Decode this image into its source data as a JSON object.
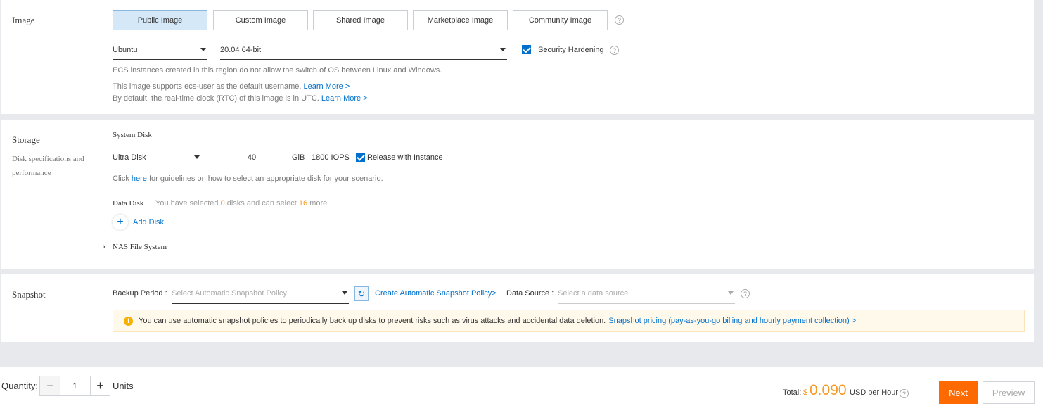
{
  "image": {
    "title": "Image",
    "tabs": [
      "Public Image",
      "Custom Image",
      "Shared Image",
      "Marketplace Image",
      "Community Image"
    ],
    "os": "Ubuntu",
    "version": "20.04 64-bit",
    "security_hardening": "Security Hardening",
    "note1": "ECS instances created in this region do not allow the switch of OS between Linux and Windows.",
    "note2": "This image supports ecs-user as the default username.",
    "note3": "By default, the real-time clock (RTC) of this image is in UTC.",
    "learn_more": "Learn More >"
  },
  "storage": {
    "title": "Storage",
    "subtitle": "Disk specifications and performance",
    "system_disk": "System Disk",
    "disk_type": "Ultra Disk",
    "size": "40",
    "unit": "GiB",
    "iops": "1800 IOPS",
    "release": "Release with Instance",
    "click": "Click",
    "here": "here",
    "guideline": "for guidelines on how to select an appropriate disk for your scenario.",
    "data_disk": "Data Disk",
    "sel_pre": "You have selected",
    "sel_count": "0",
    "sel_mid": "disks and can select",
    "sel_more": "16",
    "sel_post": "more.",
    "add_disk": "Add Disk",
    "nas": "NAS File System"
  },
  "snapshot": {
    "title": "Snapshot",
    "backup_label": "Backup Period :",
    "backup_placeholder": "Select Automatic Snapshot Policy",
    "create_policy": "Create Automatic Snapshot Policy>",
    "source_label": "Data Source :",
    "source_placeholder": "Select a data source",
    "notice": "You can use automatic snapshot policies to periodically back up disks to prevent risks such as virus attacks and accidental data deletion.",
    "pricing_link": "Snapshot pricing (pay-as-you-go billing and hourly payment collection) >"
  },
  "footer": {
    "quantity_label": "Quantity:",
    "quantity": "1",
    "units": "Units",
    "total_label": "Total:",
    "currency": "$",
    "price": "0.090",
    "price_unit": "USD per Hour",
    "next": "Next",
    "preview": "Preview"
  },
  "colors": {
    "accent": "#0070cc",
    "next": "#ff6a00",
    "warning": "#f59a23"
  }
}
